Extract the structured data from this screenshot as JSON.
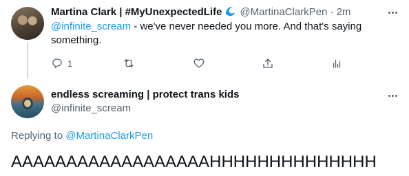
{
  "tweet1": {
    "display_name": "Martina Clark | #MyUnexpectedLife",
    "verified_icon": "wave-badge-icon",
    "handle": "@MartinaClarkPen",
    "separator": "·",
    "time": "2m",
    "mention": "@infinite_scream",
    "text_line1": " - we've never needed you more. And that's saying",
    "text_line2": "something.",
    "reply_count": "1",
    "actions": [
      "reply-icon",
      "retweet-icon",
      "like-icon",
      "share-icon",
      "analytics-icon"
    ]
  },
  "tweet2": {
    "display_name": "endless screaming | protect trans kids",
    "handle": "@infinite_scream",
    "replying_prefix": "Replying to ",
    "replying_handle": "@MartinaClarkPen",
    "text": "AAAAAAAAAAAAAAAAAAHHHHHHHHHHHHHH"
  },
  "colors": {
    "accent": "#1d9bf0",
    "text": "#0f1419",
    "muted": "#536471",
    "thread_line": "#cfd9de"
  }
}
